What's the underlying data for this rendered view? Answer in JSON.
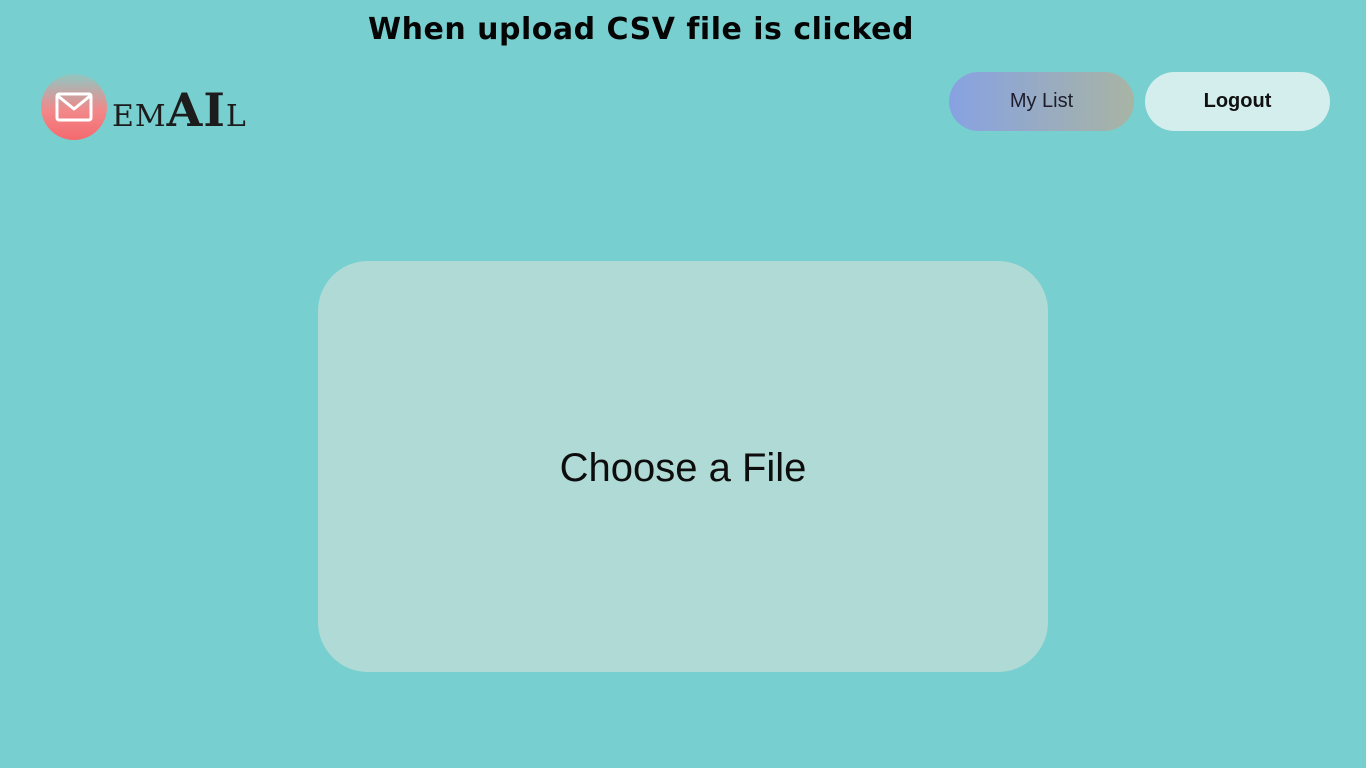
{
  "annotation": {
    "caption": "When upload CSV file is clicked"
  },
  "header": {
    "logo": {
      "icon": "envelope-icon",
      "wordmark_prefix": "EM",
      "wordmark_highlight": "AI",
      "wordmark_suffix": "L"
    },
    "nav": {
      "my_list_label": "My List",
      "logout_label": "Logout"
    }
  },
  "upload": {
    "dropzone_label": "Choose a File"
  },
  "colors": {
    "background": "#78cfcf",
    "dropzone": "#b0dad6",
    "logout_button": "#d3eeed",
    "my_list_gradient_start": "#87a2e2",
    "my_list_gradient_end": "#a8b4a4",
    "logo_gradient_top": "#8fc7c2",
    "logo_gradient_bottom": "#f46a6e"
  }
}
